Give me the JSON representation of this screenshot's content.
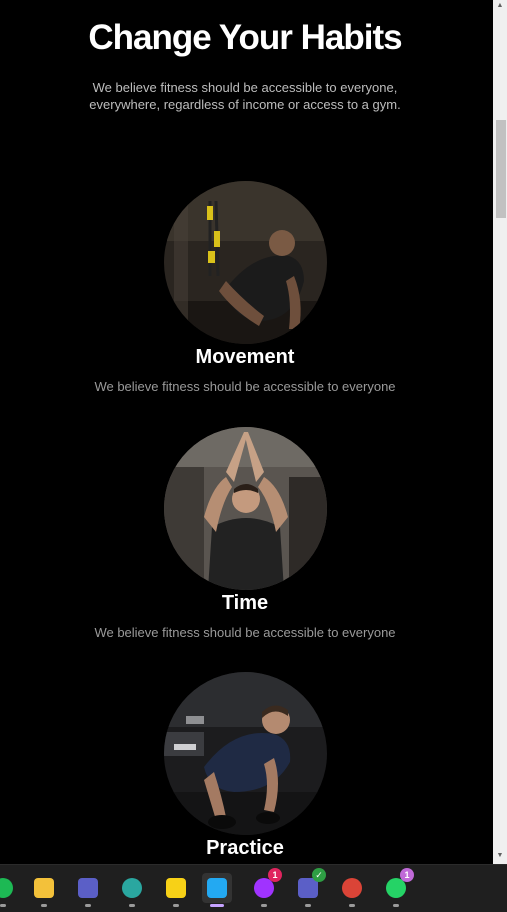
{
  "hero": {
    "title": "Change Your Habits",
    "intro": "We believe fitness should be accessible to everyone, everywhere, regardless of income or access to a gym."
  },
  "features": [
    {
      "title": "Movement",
      "description": "We believe fitness should be accessible to everyone"
    },
    {
      "title": "Time",
      "description": "We believe fitness should be accessible to everyone"
    },
    {
      "title": "Practice",
      "description": ""
    }
  ],
  "scrollbar": {
    "up_arrow": "▲",
    "down_arrow": "▼"
  },
  "taskbar": {
    "items": [
      {
        "name": "spotify-icon",
        "color": "#1db954"
      },
      {
        "name": "file-explorer-icon",
        "color": "#f3c13a"
      },
      {
        "name": "teams-icon",
        "color": "#5b5fc7"
      },
      {
        "name": "browser-profile-icon",
        "color": "#2aa7a0"
      },
      {
        "name": "sticky-notes-icon",
        "color": "#f7d117"
      },
      {
        "name": "vscode-icon",
        "color": "#23a9f2",
        "active": true
      },
      {
        "name": "messenger-icon",
        "color": "#a033ff",
        "badge": "1",
        "badge_color": "#e0245e"
      },
      {
        "name": "teams-work-icon",
        "color": "#5b5fc7",
        "badge": "✓",
        "badge_color": "#2e9e44"
      },
      {
        "name": "chrome-icon",
        "color": "#db4437"
      },
      {
        "name": "whatsapp-icon",
        "color": "#25d366",
        "badge": "1",
        "badge_color": "#c06ad8"
      }
    ]
  }
}
